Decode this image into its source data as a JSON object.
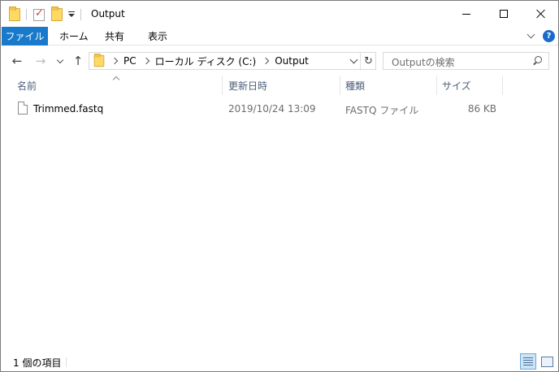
{
  "window": {
    "title": "Output"
  },
  "ribbon": {
    "tabs": [
      {
        "label": "ファイル"
      },
      {
        "label": "ホーム"
      },
      {
        "label": "共有"
      },
      {
        "label": "表示"
      }
    ],
    "help_label": "?"
  },
  "navigation": {
    "breadcrumb": [
      "PC",
      "ローカル ディスク (C:)",
      "Output"
    ],
    "refresh_glyph": "↻",
    "search_placeholder": "Outputの検索"
  },
  "columns": [
    {
      "label": "名前"
    },
    {
      "label": "更新日時"
    },
    {
      "label": "種類"
    },
    {
      "label": "サイズ"
    }
  ],
  "files": [
    {
      "name": "Trimmed.fastq",
      "modified": "2019/10/24 13:09",
      "type": "FASTQ ファイル",
      "size": "86 KB"
    }
  ],
  "status": {
    "item_count": "1 個の項目"
  },
  "colors": {
    "accent": "#1979ca",
    "header_text": "#4c607a",
    "secondary_text": "#6d6d6d"
  }
}
